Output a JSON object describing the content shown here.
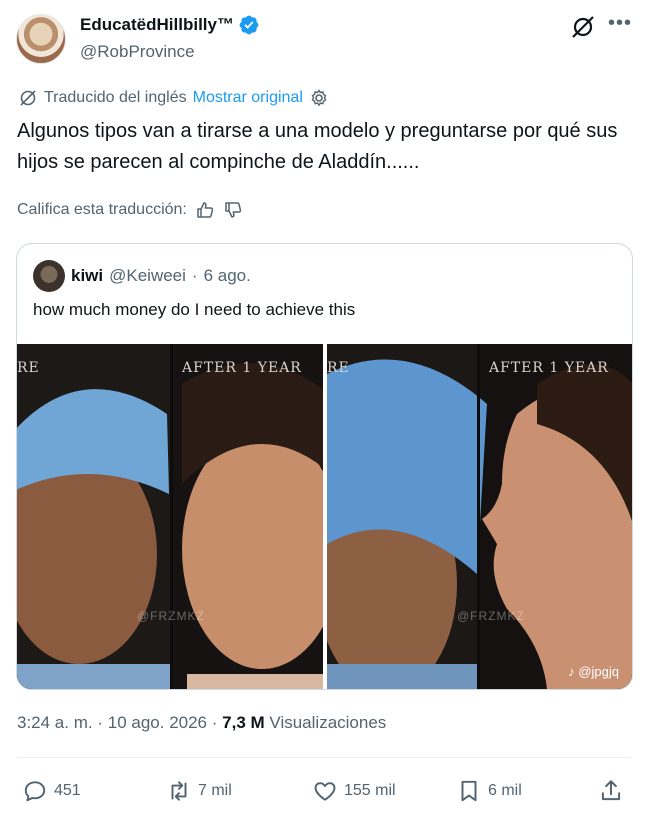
{
  "author": {
    "display_name": "EducatëdHillbilly™",
    "handle": "@RobProvince"
  },
  "translation": {
    "status": "Traducido del inglés",
    "show_original": "Mostrar original"
  },
  "tweet_text": "Algunos tipos van a tirarse a una modelo y preguntarse por qué sus hijos se parecen al compinche de Aladdín......",
  "rate_translation": "Califica esta traducción:",
  "quote": {
    "name": "kiwi",
    "handle": "@Keiweei",
    "separator": "·",
    "date": "6 ago.",
    "text": "how much money do I need to achieve this",
    "images": [
      {
        "label_left": "RE",
        "label_right": "AFTER 1 YEAR",
        "watermark": "@FRZMKZ"
      },
      {
        "label_left": "RE",
        "label_right": "AFTER 1 YEAR",
        "watermark": "@FRZMKZ",
        "tiktok": "@jpgjq"
      }
    ]
  },
  "meta": {
    "time": "3:24 a. m.",
    "dot1": "·",
    "date": "10 ago. 2026",
    "dot2": "·",
    "views_count": "7,3 M",
    "views_label": "Visualizaciones"
  },
  "actions": {
    "replies": "451",
    "reposts": "7 mil",
    "likes": "155 mil",
    "bookmarks": "6 mil"
  },
  "colors": {
    "accent": "#1d9bf0",
    "secondary_text": "#536471",
    "primary_text": "#0f1419",
    "border": "#cfd9de"
  }
}
